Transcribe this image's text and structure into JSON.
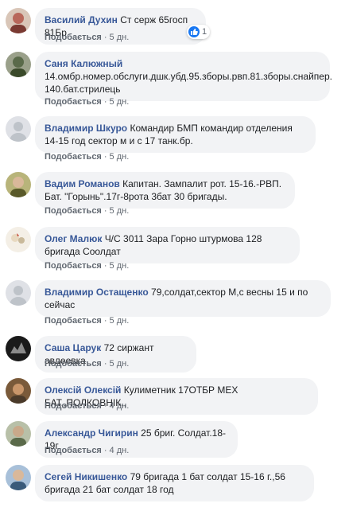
{
  "comments": [
    {
      "author": "Василий Духин",
      "text": "Ст серж 65госп 81Бр",
      "like_label": "Подобається",
      "separator": "·",
      "time": "5 дн.",
      "reaction_count": "1",
      "avatar_color": "#b8675a"
    },
    {
      "author": "Саня Калюжный",
      "text": "14.омбр.номер.обслуги.дшк.убд.95.зборы.рвп.81.зборы.снайпер. 140.бат.стрилець",
      "like_label": "Подобається",
      "separator": "·",
      "time": "5 дн.",
      "avatar_color": "#5a6a4a"
    },
    {
      "author": "Владимир Шкуро",
      "text": "Командир БМП командир отделения 14-15 год сектор м и с 17 танк.бр.",
      "like_label": "Подобається",
      "separator": "·",
      "time": "5 дн.",
      "avatar_color": "#c9ccd1"
    },
    {
      "author": "Вадим Романов",
      "text": "Капитан. Зампалит рот. 15-16.-РВП. Бат. \"Горынь\".17г-8рота 3бат 30 бригады.",
      "like_label": "Подобається",
      "separator": "·",
      "time": "5 дн.",
      "avatar_color": "#7a7a3a"
    },
    {
      "author": "Олег Малюк",
      "text": "Ч/С 3011 Зара Горно штурмова 128 бригада Соолдат",
      "like_label": "Подобається",
      "separator": "·",
      "time": "5 дн.",
      "avatar_color": "#e8d9c0"
    },
    {
      "author": "Владимир Остащенко",
      "text": "79,солдат,сектор М,с весны 15 и по сейчас",
      "like_label": "Подобається",
      "separator": "·",
      "time": "5 дн.",
      "avatar_color": "#c9ccd1"
    },
    {
      "author": "Саша Царук",
      "text": "72 сиржант авдеевка",
      "like_label": "Подобається",
      "separator": "·",
      "time": "5 дн.",
      "avatar_color": "#2a2a2a"
    },
    {
      "author": "Олексій Олексій",
      "text": "Кулиметник 17ОТБР МЕХ БАТ,,ПОЛКОВНІК,,",
      "like_label": "Подобається",
      "separator": "·",
      "time": "4 дн.",
      "avatar_color": "#8a6a4a"
    },
    {
      "author": "Александр Чигирин",
      "text": "25 бриг. Солдат.18-19г",
      "like_label": "Подобається",
      "separator": "·",
      "time": "4 дн.",
      "avatar_color": "#6a7a5a"
    },
    {
      "author": "Сегей Никишенко",
      "text": "79 бригада 1 бат солдат 15-16 г.,56 бригада 21 бат солдат 18 год",
      "like_label": "Подобається",
      "separator": "·",
      "time": "4 дн.",
      "avatar_color": "#5a7a9a"
    }
  ]
}
